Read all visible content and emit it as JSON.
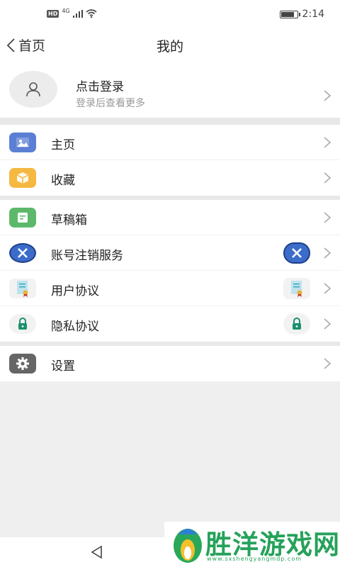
{
  "status_bar": {
    "network_badge": "HD",
    "network_type": "4G",
    "battery_percent": 85,
    "time": "2:14"
  },
  "navbar": {
    "back_label": "首页",
    "title": "我的"
  },
  "profile": {
    "name": "点击登录",
    "subtitle": "登录后查看更多"
  },
  "sections": [
    [
      {
        "label": "主页",
        "icon": "image-icon",
        "color": "#5b7fd4"
      },
      {
        "label": "收藏",
        "icon": "box-icon",
        "color": "#f5b841"
      }
    ],
    [
      {
        "label": "草稿箱",
        "icon": "draft-icon",
        "color": "#5cb96b"
      },
      {
        "label": "账号注销服务",
        "icon": "cancel-account-icon",
        "color": "#2f5bb5"
      },
      {
        "label": "用户协议",
        "icon": "certificate-icon",
        "color": "#3aa8b8"
      },
      {
        "label": "隐私协议",
        "icon": "lock-icon",
        "color": "#1a8f6e"
      }
    ],
    [
      {
        "label": "设置",
        "icon": "gear-icon",
        "color": "#666666"
      }
    ]
  ],
  "watermark": {
    "title": "胜洋游戏网",
    "url": "www.sxshengyangmdp.com"
  }
}
